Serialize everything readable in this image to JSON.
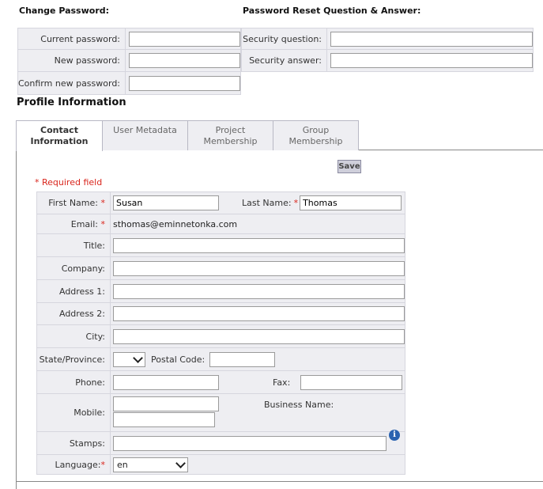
{
  "change_password": {
    "title": "Change Password:",
    "current_label": "Current password:",
    "new_label": "New password:",
    "confirm_label": "Confirm new password:"
  },
  "reset": {
    "title": "Password Reset Question & Answer:",
    "question_label": "Security question:",
    "answer_label": "Security answer:"
  },
  "profile": {
    "heading": "Profile Information"
  },
  "tabs": [
    {
      "line1": "Contact",
      "line2": "Information"
    },
    {
      "line1": "User Metadata",
      "line2": ""
    },
    {
      "line1": "Project",
      "line2": "Membership"
    },
    {
      "line1": "Group",
      "line2": "Membership"
    }
  ],
  "save_label": "Save",
  "required_note": "* Required field",
  "form": {
    "first_name_label": "First Name:",
    "first_name_value": "Susan",
    "last_name_label": "Last Name:",
    "last_name_value": "Thomas",
    "email_label": "Email:",
    "email_value": "sthomas@eminnetonka.com",
    "title_label": "Title:",
    "company_label": "Company:",
    "address1_label": "Address 1:",
    "address2_label": "Address 2:",
    "city_label": "City:",
    "state_label": "State/Province:",
    "state_value": "",
    "postal_label": "Postal Code:",
    "phone_label": "Phone:",
    "fax_label": "Fax:",
    "mobile_label": "Mobile:",
    "business_label": "Business Name:",
    "stamps_label": "Stamps:",
    "language_label": "Language:",
    "language_value": "en",
    "required_star": "*"
  },
  "colors": {
    "required": "#d9251c",
    "panel": "#eeeef2",
    "info_icon": "#2a63b0"
  }
}
